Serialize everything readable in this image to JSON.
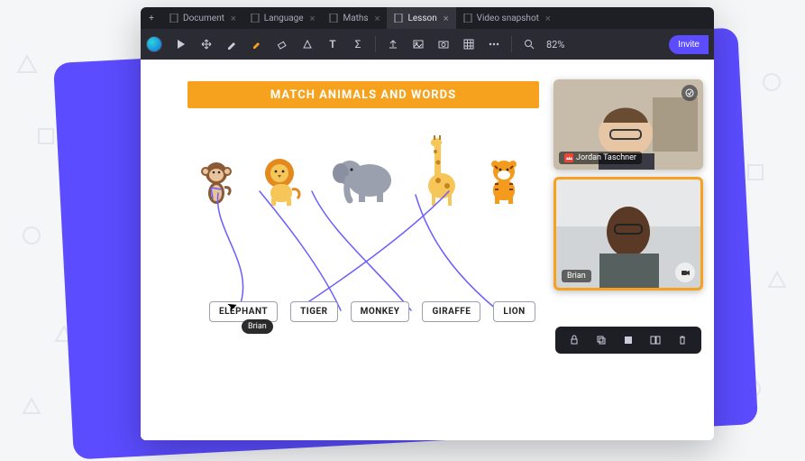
{
  "tabs": [
    {
      "label": "Document"
    },
    {
      "label": "Language"
    },
    {
      "label": "Maths"
    },
    {
      "label": "Lesson",
      "active": true
    },
    {
      "label": "Video snapshot"
    }
  ],
  "toolbar": {
    "zoom_label": "82%",
    "invite_label": "Invite"
  },
  "lesson": {
    "title": "MATCH ANIMALS AND WORDS",
    "animals": [
      {
        "name": "monkey"
      },
      {
        "name": "lion"
      },
      {
        "name": "elephant"
      },
      {
        "name": "giraffe"
      },
      {
        "name": "tiger"
      }
    ],
    "words": [
      {
        "label": "ELEPHANT"
      },
      {
        "label": "TIGER"
      },
      {
        "label": "MONKEY"
      },
      {
        "label": "GIRAFFE"
      },
      {
        "label": "LION"
      }
    ]
  },
  "cursor": {
    "user": "Brian"
  },
  "video": {
    "host_name": "Jordan Taschner",
    "guest_name": "Brian"
  }
}
